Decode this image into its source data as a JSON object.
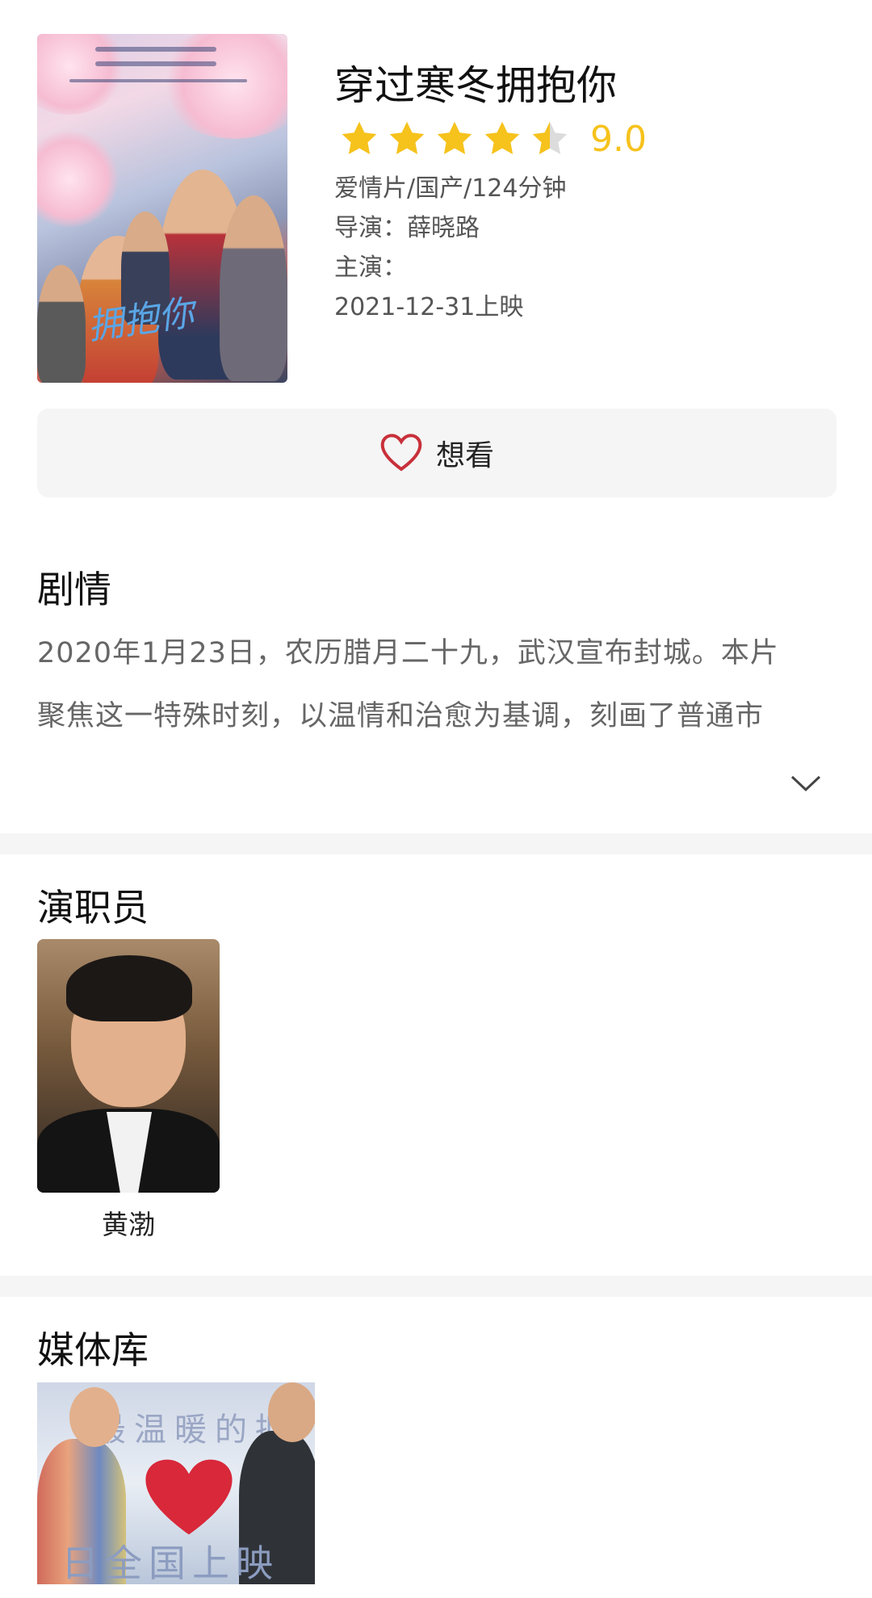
{
  "movie": {
    "title": "穿过寒冬拥抱你",
    "score": "9.0",
    "rating_stars": 4.5,
    "rating_max": 5,
    "genre_line": "爱情片/国产/124分钟",
    "director_line": "导演：薛晓路",
    "cast_line": "主演：",
    "release_line": "2021-12-31上映",
    "poster_text": "拥抱你"
  },
  "actions": {
    "want_label": "想看"
  },
  "plot": {
    "heading": "剧情",
    "line1": "2020年1月23日，农历腊月二十九，武汉宣布封城。本片",
    "line2": "聚焦这一特殊时刻，以温情和治愈为基调，刻画了普通市"
  },
  "cast": {
    "heading": "演职员",
    "members": [
      {
        "name": "黄渤"
      }
    ]
  },
  "media": {
    "heading": "媒体库",
    "thumb_text_top": "最温暖的拥",
    "thumb_text_bottom": "日全国上映"
  },
  "colors": {
    "star": "#f6c21c",
    "star_empty": "#dcdcdc",
    "heart": "#c8303a",
    "button_bg": "#f5f5f5",
    "divider": "#f5f5f5"
  }
}
